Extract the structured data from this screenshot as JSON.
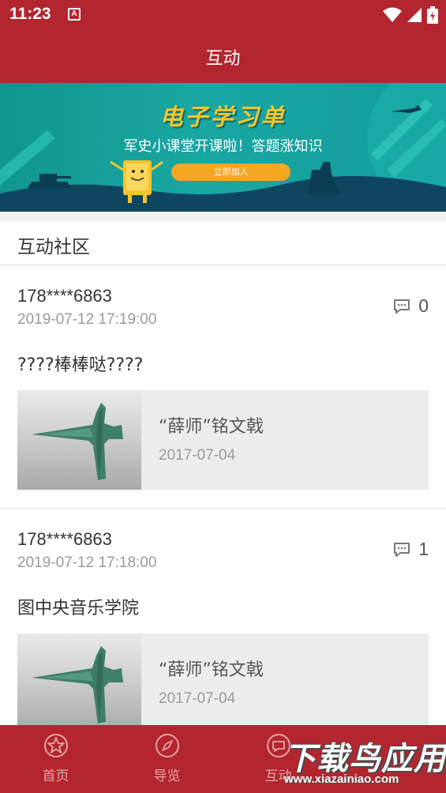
{
  "status_bar": {
    "time": "11:23",
    "app_icon_letter": "A"
  },
  "app_bar": {
    "title": "互动"
  },
  "banner": {
    "title": "电子学习单",
    "subtitle": "军史小课堂开课啦！答题涨知识",
    "button_label": "立即加入"
  },
  "section": {
    "title": "互动社区"
  },
  "posts": [
    {
      "user": "178****6863",
      "time": "2019-07-12 17:19:00",
      "comment_count": "0",
      "text": "????棒棒哒????",
      "card": {
        "title": "“薛师”铭文戟",
        "date": "2017-07-04"
      }
    },
    {
      "user": "178****6863",
      "time": "2019-07-12 17:18:00",
      "comment_count": "1",
      "text": "图中央音乐学院",
      "card": {
        "title": "“薛师”铭文戟",
        "date": "2017-07-04"
      }
    }
  ],
  "tabs": [
    {
      "label": "首页",
      "icon": "star-icon"
    },
    {
      "label": "导览",
      "icon": "compass-icon"
    },
    {
      "label": "互动",
      "icon": "chat-icon"
    }
  ],
  "watermark": {
    "text": "下载鸟应用",
    "url": "www.xiazainiao.com"
  },
  "colors": {
    "primary": "#b3262f",
    "banner_teal": "#1aa7a3",
    "banner_title": "#f7c42e",
    "button_orange": "#f5a623"
  }
}
